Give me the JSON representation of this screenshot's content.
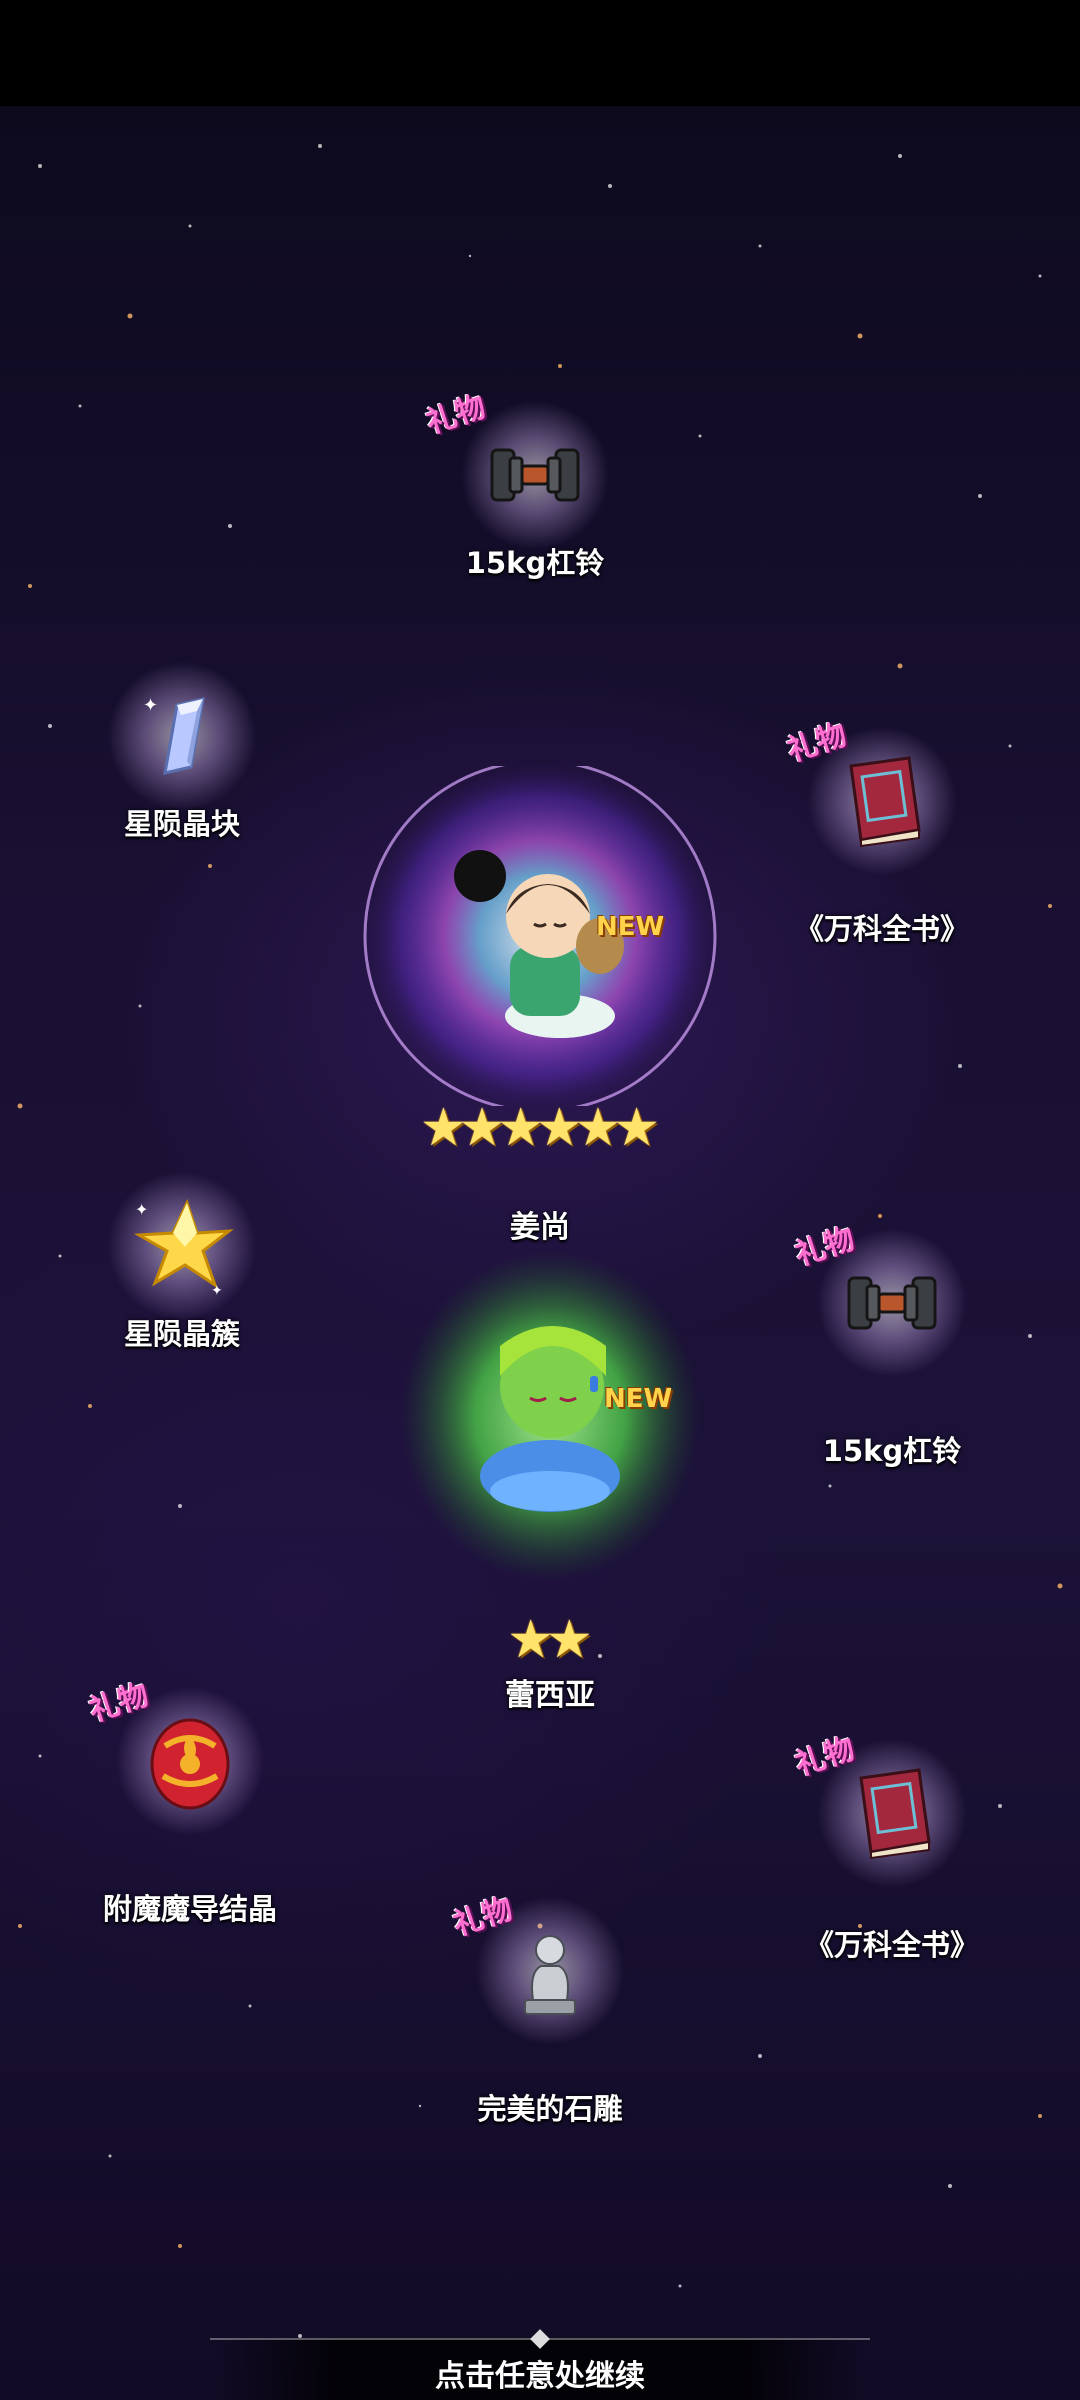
{
  "gift_tag": "礼物",
  "new_badge": "NEW",
  "items": {
    "barbell_top": "15kg杠铃",
    "crystal_shard": "星陨晶块",
    "encyclopedia_top": "《万科全书》",
    "crystal_cluster": "星陨晶簇",
    "barbell_mid": "15kg杠铃",
    "enchant_crystal": "附魔魔导结晶",
    "encyclopedia_bottom": "《万科全书》",
    "statue": "完美的石雕"
  },
  "heroes": {
    "jiangshang": {
      "name": "姜尚",
      "stars": 6
    },
    "lexia": {
      "name": "蕾西亚",
      "stars": 2
    }
  },
  "continue_hint": "点击任意处继续",
  "colors": {
    "gift_tag": "#ff6fd0",
    "new_badge": "#ffd34a",
    "star": "#ffe36a",
    "rainbow_glow": "#b26bff",
    "green_glow": "#53e04a"
  }
}
